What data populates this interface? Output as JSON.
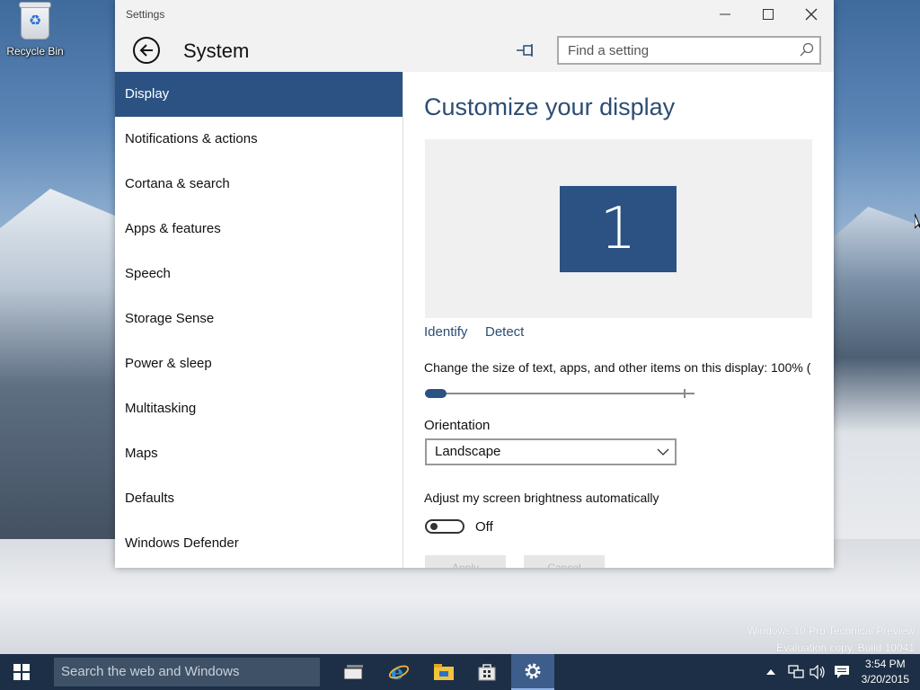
{
  "desktop": {
    "recycle_bin_label": "Recycle Bin",
    "watermark_line1": "Windows 10 Pro Technical Preview",
    "watermark_line2": "Evaluation copy. Build 10041"
  },
  "window": {
    "title": "Settings",
    "controls": {
      "minimize": "minimize-icon",
      "maximize": "maximize-icon",
      "close": "close-icon"
    }
  },
  "header": {
    "section_title": "System",
    "search_placeholder": "Find a setting"
  },
  "sidebar": {
    "items": [
      {
        "label": "Display",
        "active": true
      },
      {
        "label": "Notifications & actions"
      },
      {
        "label": "Cortana & search"
      },
      {
        "label": "Apps & features"
      },
      {
        "label": "Speech"
      },
      {
        "label": "Storage Sense"
      },
      {
        "label": "Power & sleep"
      },
      {
        "label": "Multitasking"
      },
      {
        "label": "Maps"
      },
      {
        "label": "Defaults"
      },
      {
        "label": "Windows Defender"
      }
    ]
  },
  "main": {
    "heading": "Customize your display",
    "monitor_number": "1",
    "identify_label": "Identify",
    "detect_label": "Detect",
    "scale_label": "Change the size of text, apps, and other items on this display: 100% (",
    "scale_slider_value": 0,
    "orientation_label": "Orientation",
    "orientation_value": "Landscape",
    "brightness_label": "Adjust my screen brightness automatically",
    "brightness_toggle_state": "Off",
    "apply_label": "Apply",
    "cancel_label": "Cancel"
  },
  "taskbar": {
    "search_placeholder": "Search the web and Windows",
    "time": "3:54 PM",
    "date": "3/20/2015",
    "apps": [
      "task-view-icon",
      "internet-explorer-icon",
      "file-explorer-icon",
      "store-icon",
      "settings-gear-icon"
    ]
  },
  "colors": {
    "accent": "#2b5282",
    "heading": "#2b4d72",
    "taskbar": "#1c2f46"
  }
}
